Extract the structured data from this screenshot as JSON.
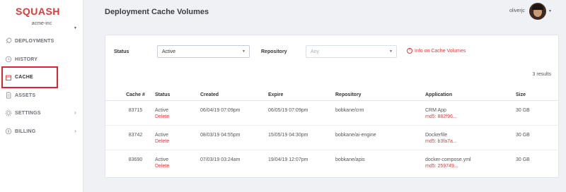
{
  "sidebar": {
    "logo": "SQUASH",
    "org": "acme-inc",
    "items": [
      {
        "label": "DEPLOYMENTS",
        "icon": "rocket-icon",
        "has_chevron": false
      },
      {
        "label": "HISTORY",
        "icon": "history-icon",
        "has_chevron": false
      },
      {
        "label": "CACHE",
        "icon": "cache-icon",
        "has_chevron": false,
        "active": true
      },
      {
        "label": "ASSETS",
        "icon": "document-icon",
        "has_chevron": false
      },
      {
        "label": "SETTINGS",
        "icon": "gear-icon",
        "has_chevron": true
      },
      {
        "label": "BILLING",
        "icon": "billing-icon",
        "has_chevron": true
      }
    ]
  },
  "header": {
    "title": "Deployment Cache Volumes",
    "user": "oliverjc"
  },
  "filters": {
    "status_label": "Status",
    "status_value": "Active",
    "repository_label": "Repository",
    "repository_placeholder": "Any",
    "info_link": "Info on Cache Volumes"
  },
  "results_count": "3 results",
  "table": {
    "headers": [
      "Cache #",
      "Status",
      "Created",
      "Expire",
      "Repository",
      "Application",
      "Size"
    ],
    "rows": [
      {
        "cache": "83715",
        "status": "Active",
        "action": "Delete",
        "created": "06/04/19 07:09pm",
        "expire": "06/05/19 07:09pm",
        "repository": "bobkane/crm",
        "application": "CRM App",
        "md5": "md5: 882f96...",
        "size": "30 GB"
      },
      {
        "cache": "83742",
        "status": "Active",
        "action": "Delete",
        "created": "08/03/19 04:55pm",
        "expire": "15/05/19 04:30pm",
        "repository": "bobkane/ai-engine",
        "application": "Dockerfile",
        "md5": "md5: b3fa7a...",
        "size": "30 GB"
      },
      {
        "cache": "83690",
        "status": "Active",
        "action": "Delete",
        "created": "07/03/19 03:24am",
        "expire": "19/04/19 12:07pm",
        "repository": "bobkane/apis",
        "application": "docker-compose.yml",
        "md5": "md5: 259749...",
        "size": "30 GB"
      }
    ]
  },
  "colors": {
    "brand": "#e03b3b",
    "active_highlight": "#e0242c"
  }
}
